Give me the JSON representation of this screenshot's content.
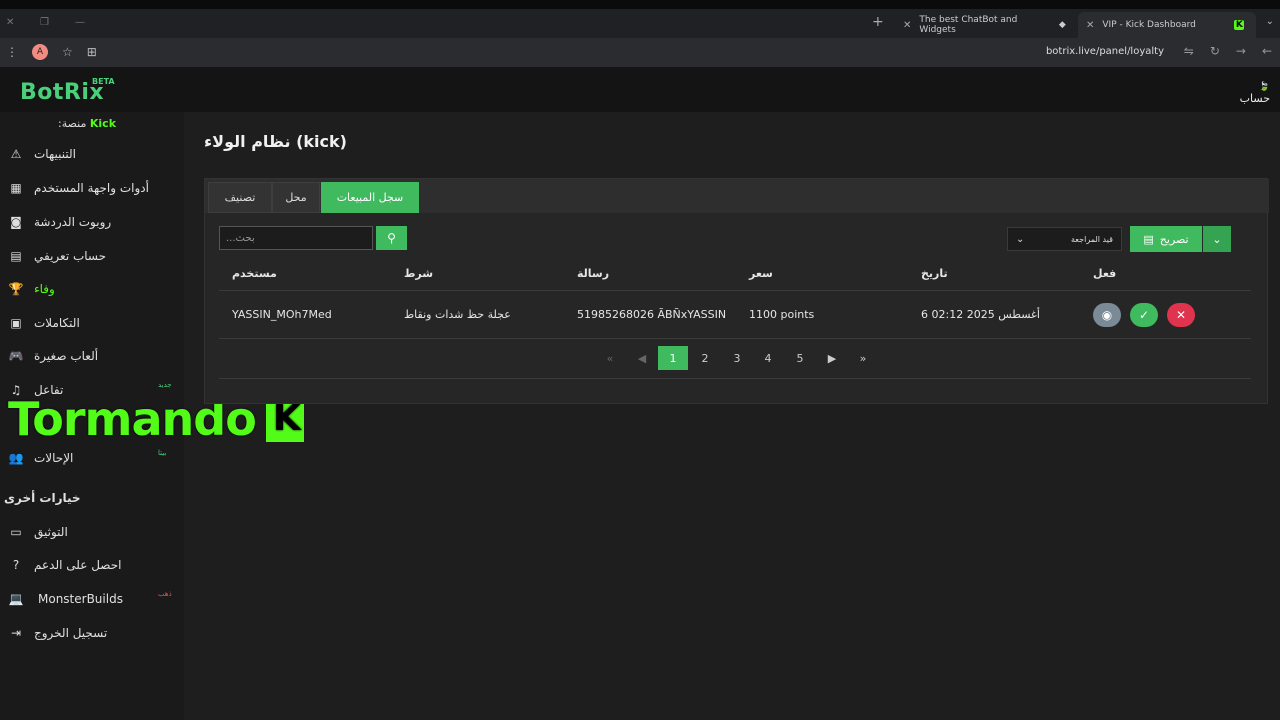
{
  "browser": {
    "tabs": [
      {
        "title": "The best ChatBot and Widgets",
        "active": false
      },
      {
        "title": "VIP - Kick Dashboard",
        "active": true
      }
    ],
    "profile_initial": "A",
    "url": "botrix.live/panel/loyalty"
  },
  "app": {
    "logo": "BotRix",
    "beta": "BETA",
    "account_label": "حساب",
    "platform_label": ":منصة",
    "platform_value": "Kick"
  },
  "sidebar": {
    "items": [
      {
        "label": "التنبيهات",
        "icon": "warning-icon"
      },
      {
        "label": "أدوات واجهة المستخدم",
        "icon": "grid-icon"
      },
      {
        "label": "روبوت الدردشة",
        "icon": "robot-icon"
      },
      {
        "label": "حساب تعريفي",
        "icon": "id-card-icon"
      },
      {
        "label": "وفاء",
        "icon": "trophy-icon",
        "active": true
      },
      {
        "label": "التكاملات",
        "icon": "chat-icon"
      },
      {
        "label": "ألعاب صغيرة",
        "icon": "gamepad-icon"
      },
      {
        "label": "تفاعل",
        "icon": "music-icon",
        "badge": "جديد"
      },
      {
        "label": "الإحالات",
        "icon": "users-icon",
        "badge": "بيتا"
      }
    ],
    "section_title": "خيارات أخرى",
    "other_items": [
      {
        "label": "التوثيق",
        "icon": "book-icon"
      },
      {
        "label": "احصل على الدعم",
        "icon": "question-icon"
      },
      {
        "label": "MonsterBuilds",
        "icon": "laptop-icon",
        "badge": "ذهب"
      },
      {
        "label": "تسجيل الخروج",
        "icon": "logout-icon"
      }
    ]
  },
  "overlay": {
    "text": "Tormando"
  },
  "main": {
    "title": "نظام الولاء (kick)",
    "tabs": [
      "تصنيف",
      "محل",
      "سجل المبيعات"
    ],
    "active_tab": "سجل المبيعات",
    "search_placeholder": "...بحث",
    "filter_label": "قيد المراجعة",
    "export_label": "تصريح",
    "table": {
      "headers": [
        "مستخدم",
        "شرط",
        "رسالة",
        "سعر",
        "تاريخ",
        "فعل"
      ],
      "rows": [
        {
          "user": "YASSIN_MOh7Med",
          "condition": "عجلة حظ شدات ونقاط",
          "message": "51985268026 ÃBÑxYASSIN",
          "price": "1100 points",
          "date": "6 أغسطس 2025 02:12"
        }
      ]
    },
    "pagination": {
      "pages": [
        "1",
        "2",
        "3",
        "4",
        "5"
      ],
      "current": "1"
    }
  }
}
